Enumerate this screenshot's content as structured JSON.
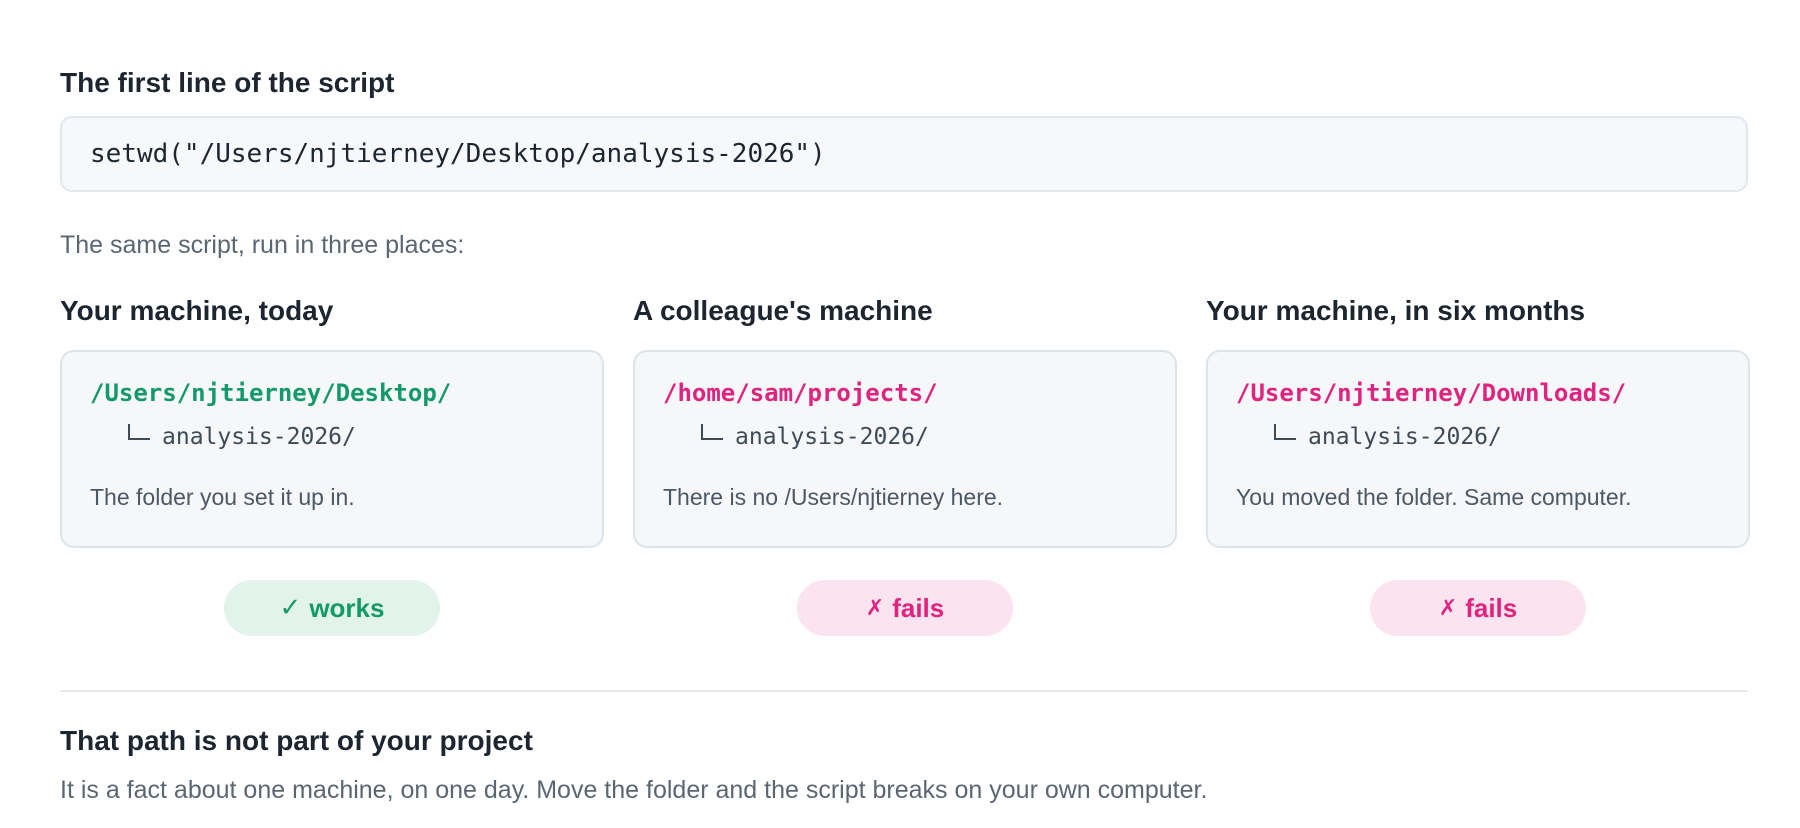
{
  "script": {
    "heading": "The first line of the script",
    "code": "setwd(\"/Users/njtierney/Desktop/analysis-2026\")"
  },
  "intro": "The same script, run in three places:",
  "scenarios": [
    {
      "heading": "Your machine, today",
      "path": "/Users/njtierney/Desktop/",
      "subfolder": "analysis-2026/",
      "note": "The folder you set it up in.",
      "status": "ok",
      "badge_icon": "check-icon",
      "badge_glyph": "✓",
      "badge_label": "works",
      "color": "#14996a"
    },
    {
      "heading": "A colleague's machine",
      "path": "/home/sam/projects/",
      "subfolder": "analysis-2026/",
      "note": "There is no /Users/njtierney here.",
      "status": "bad",
      "badge_icon": "cross-icon",
      "badge_glyph": "✗",
      "badge_label": "fails",
      "color": "#e0237e"
    },
    {
      "heading": "Your machine, in six months",
      "path": "/Users/njtierney/Downloads/",
      "subfolder": "analysis-2026/",
      "note": "You moved the folder. Same computer.",
      "status": "bad",
      "badge_icon": "cross-icon",
      "badge_glyph": "✗",
      "badge_label": "fails",
      "color": "#e0237e"
    }
  ],
  "conclusion": {
    "heading": "That path is not part of your project",
    "text": "It is a fact about one machine, on one day. Move the folder and the script breaks on your own computer."
  },
  "colors": {
    "ok": "#14996a",
    "bad": "#e0237e",
    "ok_bg": "#e2f3ec",
    "bad_bg": "#fbe3ef"
  }
}
